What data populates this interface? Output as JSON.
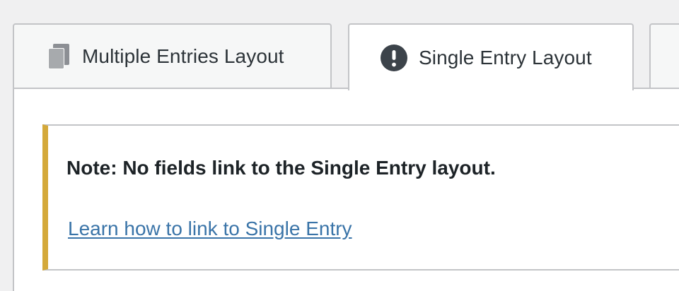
{
  "tabs": [
    {
      "label": "Multiple Entries Layout",
      "icon": "documents-icon",
      "active": false
    },
    {
      "label": "Single Entry Layout",
      "icon": "warning-icon",
      "active": true
    }
  ],
  "notice": {
    "message": "Note: No fields link to the Single Entry layout.",
    "link_text": "Learn how to link to Single Entry",
    "accent_color": "#d4a93a"
  },
  "colors": {
    "link": "#3a74a8",
    "border": "#c3c4c7",
    "background": "#f0f0f1",
    "text": "#1d2327"
  }
}
